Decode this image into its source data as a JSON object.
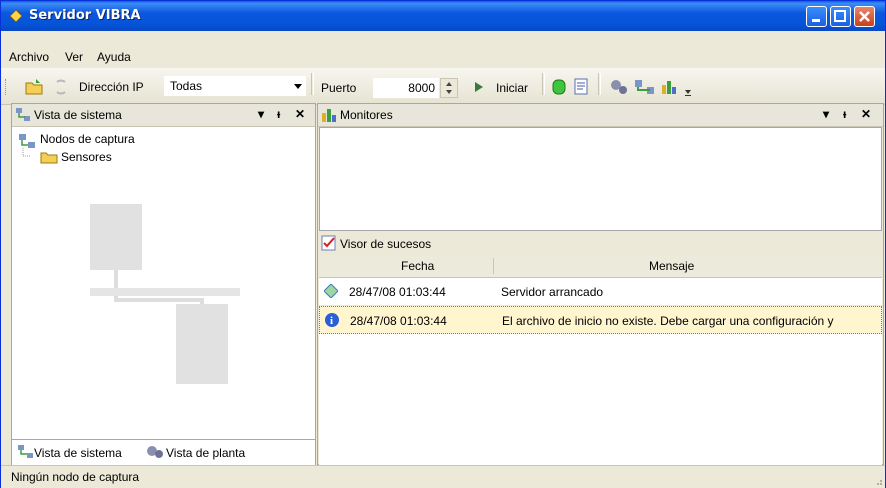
{
  "window": {
    "title": "Servidor VIBRA",
    "accent": "#0b58e0"
  },
  "menu": {
    "items": [
      "Archivo",
      "Ver",
      "Ayuda"
    ]
  },
  "toolbar": {
    "ip_label": "Dirección IP",
    "ip_selected": "Todas",
    "port_label": "Puerto",
    "port_value": "8000",
    "start_label": "Iniciar"
  },
  "left_pane": {
    "title": "Vista de sistema",
    "tree": [
      "Nodos de captura",
      "Sensores"
    ],
    "tabs": [
      "Vista de sistema",
      "Vista de planta"
    ]
  },
  "right_pane": {
    "monitors_title": "Monitores",
    "viewer_title": "Visor de sucesos",
    "columns": [
      "Fecha",
      "Mensaje"
    ],
    "events": [
      {
        "fecha": "28/47/08 01:03:44",
        "mensaje": "Servidor arrancado",
        "icon": "gem-icon"
      },
      {
        "fecha": "28/47/08 01:03:44",
        "mensaje": "El archivo de inicio no existe. Debe cargar una configuración y",
        "icon": "info-icon"
      }
    ]
  },
  "status": {
    "text": "Ningún nodo de captura"
  }
}
